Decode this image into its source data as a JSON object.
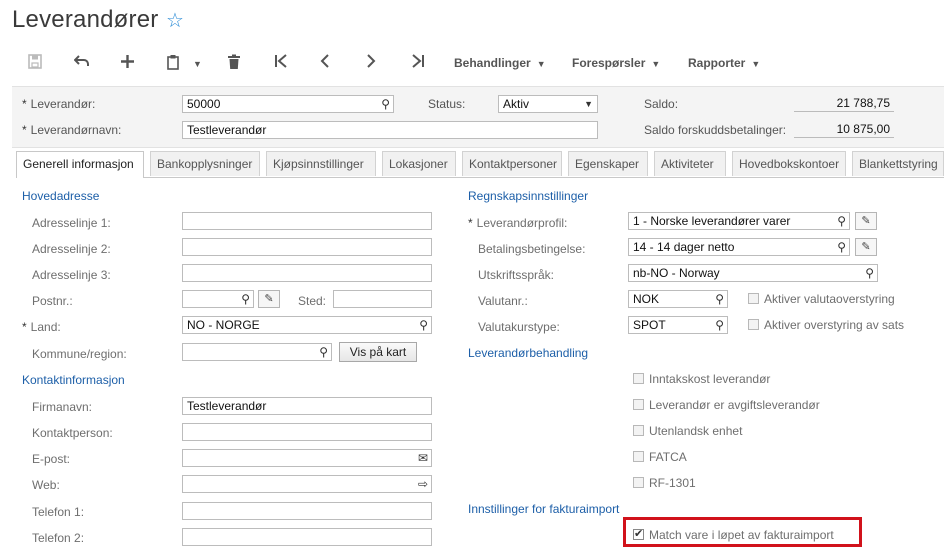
{
  "page": {
    "title": "Leverandører"
  },
  "toolbar": {
    "menus": [
      "Behandlinger",
      "Forespørsler",
      "Rapporter"
    ]
  },
  "summary": {
    "vendor_label": "Leverandør:",
    "vendor_value": "50000",
    "vendor_name_label": "Leverandørnavn:",
    "vendor_name_value": "Testleverandør",
    "status_label": "Status:",
    "status_value": "Aktiv",
    "balance_label": "Saldo:",
    "balance_value": "21 788,75",
    "prepay_label": "Saldo forskuddsbetalinger:",
    "prepay_value": "10 875,00"
  },
  "tabs": [
    "Generell informasjon",
    "Bankopplysninger",
    "Kjøpsinnstillinger",
    "Lokasjoner",
    "Kontaktpersoner",
    "Egenskaper",
    "Aktiviteter",
    "Hovedbokskontoer",
    "Blankettstyring"
  ],
  "left": {
    "address_title": "Hovedadresse",
    "addr1_label": "Adresselinje 1:",
    "addr2_label": "Adresselinje 2:",
    "addr3_label": "Adresselinje 3:",
    "postal_label": "Postnr.:",
    "city_label": "Sted:",
    "country_label": "Land:",
    "country_value": "NO - NORGE",
    "region_label": "Kommune/region:",
    "map_button": "Vis på kart",
    "contact_title": "Kontaktinformasjon",
    "company_label": "Firmanavn:",
    "company_value": "Testleverandør",
    "contact_label": "Kontaktperson:",
    "email_label": "E-post:",
    "web_label": "Web:",
    "phone1_label": "Telefon 1:",
    "phone2_label": "Telefon 2:"
  },
  "right": {
    "accounting_title": "Regnskapsinnstillinger",
    "profile_label": "Leverandørprofil:",
    "profile_value": "1 - Norske leverandører varer",
    "terms_label": "Betalingsbetingelse:",
    "terms_value": "14 - 14 dager netto",
    "lang_label": "Utskriftsspråk:",
    "lang_value": "nb-NO - Norway",
    "currency_label": "Valutanr.:",
    "currency_value": "NOK",
    "currency_override_label": "Aktiver valutaoverstyring",
    "rate_label": "Valutakurstype:",
    "rate_value": "SPOT",
    "rate_override_label": "Aktiver overstyring av sats",
    "handling_title": "Leverandørbehandling",
    "cb1": "Inntakskost leverandør",
    "cb2": "Leverandør er avgiftsleverandør",
    "cb3": "Utenlandsk enhet",
    "cb4": "FATCA",
    "cb5": "RF-1301",
    "invoice_title": "Innstillinger for fakturaimport",
    "cb6": "Match vare i løpet av fakturaimport"
  }
}
